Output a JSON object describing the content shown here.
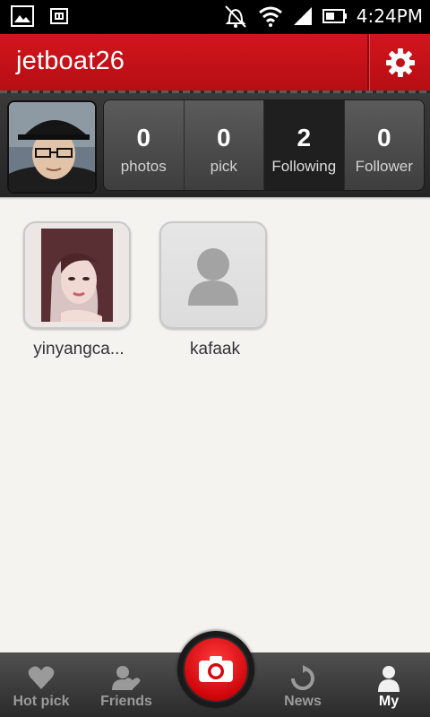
{
  "status_bar": {
    "time": "4:24PM",
    "icons": [
      "image-icon",
      "sd-card-icon",
      "alarm-off-icon",
      "wifi-icon",
      "cell-signal-icon",
      "battery-icon"
    ]
  },
  "header": {
    "title": "jetboat26",
    "settings_icon": "gear-icon"
  },
  "profile": {
    "stats": [
      {
        "count": "0",
        "label": "photos",
        "active": false
      },
      {
        "count": "0",
        "label": "pick",
        "active": false
      },
      {
        "count": "2",
        "label": "Following",
        "active": true
      },
      {
        "count": "0",
        "label": "Follower",
        "active": false
      }
    ]
  },
  "following": [
    {
      "name": "yinyangca...",
      "avatar": "photo"
    },
    {
      "name": "kafaak",
      "avatar": "placeholder-person-icon"
    }
  ],
  "bottom_nav": {
    "items": [
      {
        "label": "Hot pick",
        "icon": "heart-icon",
        "active": false
      },
      {
        "label": "Friends",
        "icon": "friends-icon",
        "active": false
      },
      {
        "label": "News",
        "icon": "refresh-icon",
        "active": false
      },
      {
        "label": "My",
        "icon": "person-icon",
        "active": true
      }
    ],
    "camera_icon": "camera-icon"
  },
  "colors": {
    "brand_red": "#c8111a",
    "active_stat_bg": "#1f1f1f",
    "content_bg": "#f4f3f0"
  }
}
